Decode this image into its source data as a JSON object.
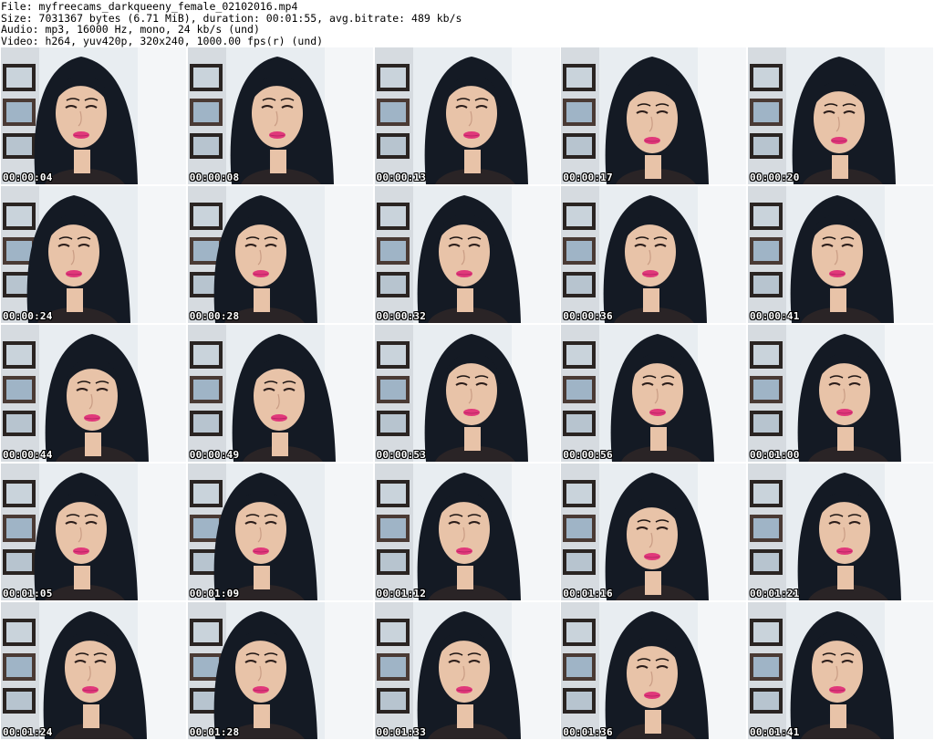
{
  "header": {
    "file": "File: myfreecams_darkqueeny_female_02102016.mp4",
    "size": "Size: 7031367 bytes (6.71 MiB), duration: 00:01:55, avg.bitrate: 489 kb/s",
    "audio": "Audio: mp3, 16000 Hz, mono, 24 kb/s (und)",
    "video": "Video: h264, yuv420p, 320x240, 1000.00 fps(r) (und)"
  },
  "thumbnails": [
    {
      "timestamp": "00:00:04",
      "pose": "tilt-left"
    },
    {
      "timestamp": "00:00:08",
      "pose": "center"
    },
    {
      "timestamp": "00:00:13",
      "pose": "tilt-right"
    },
    {
      "timestamp": "00:00:17",
      "pose": "down"
    },
    {
      "timestamp": "00:00:20",
      "pose": "down"
    },
    {
      "timestamp": "00:00:24",
      "pose": "side-left"
    },
    {
      "timestamp": "00:00:28",
      "pose": "side-left"
    },
    {
      "timestamp": "00:00:32",
      "pose": "center"
    },
    {
      "timestamp": "00:00:36",
      "pose": "center"
    },
    {
      "timestamp": "00:00:41",
      "pose": "center"
    },
    {
      "timestamp": "00:00:44",
      "pose": "down"
    },
    {
      "timestamp": "00:00:49",
      "pose": "down"
    },
    {
      "timestamp": "00:00:53",
      "pose": "tilt-right"
    },
    {
      "timestamp": "00:00:56",
      "pose": "tilt-right"
    },
    {
      "timestamp": "00:01:00",
      "pose": "tilt-right"
    },
    {
      "timestamp": "00:01:05",
      "pose": "tilt-left"
    },
    {
      "timestamp": "00:01:09",
      "pose": "side-left"
    },
    {
      "timestamp": "00:01:12",
      "pose": "center"
    },
    {
      "timestamp": "00:01:16",
      "pose": "down"
    },
    {
      "timestamp": "00:01:21",
      "pose": "tilt-right"
    },
    {
      "timestamp": "00:01:24",
      "pose": "center"
    },
    {
      "timestamp": "00:01:28",
      "pose": "side-left"
    },
    {
      "timestamp": "00:01:33",
      "pose": "center"
    },
    {
      "timestamp": "00:01:36",
      "pose": "down"
    },
    {
      "timestamp": "00:01:41",
      "pose": "center"
    }
  ],
  "colors": {
    "background": "#ffffff",
    "text": "#000000",
    "wall": "#e8edf1",
    "hair": "#141a24",
    "skin": "#e8c3a8",
    "lips": "#e0387a",
    "shelf": "#4a3a34",
    "frame_dark": "#2a2422"
  }
}
